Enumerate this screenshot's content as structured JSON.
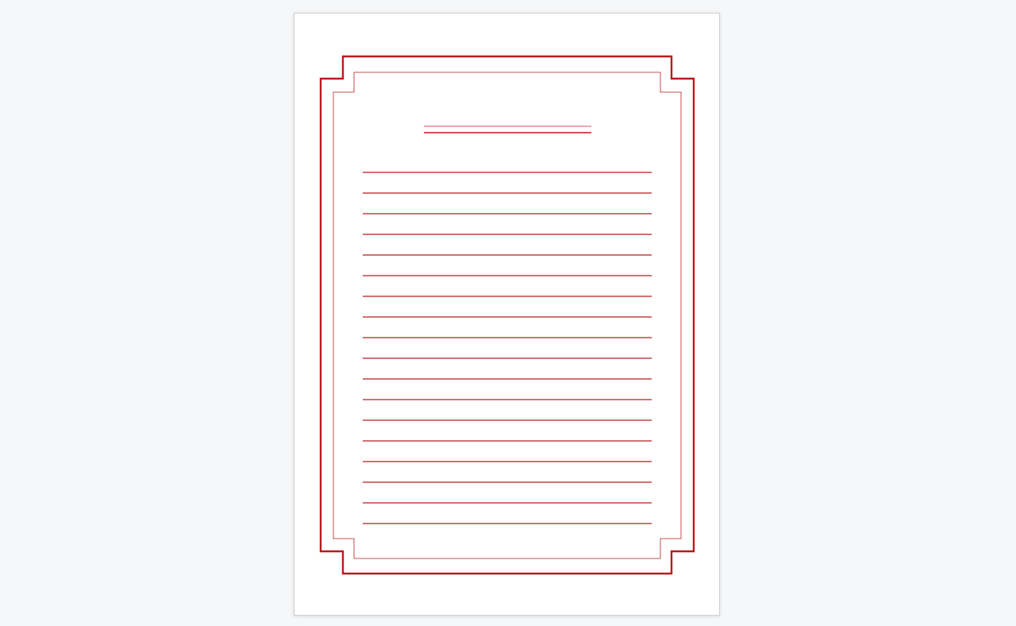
{
  "document": {
    "kind": "lined writing paper",
    "frame_color": "#b71c1c",
    "ruled_line_count": 18,
    "title_underline": "double"
  }
}
